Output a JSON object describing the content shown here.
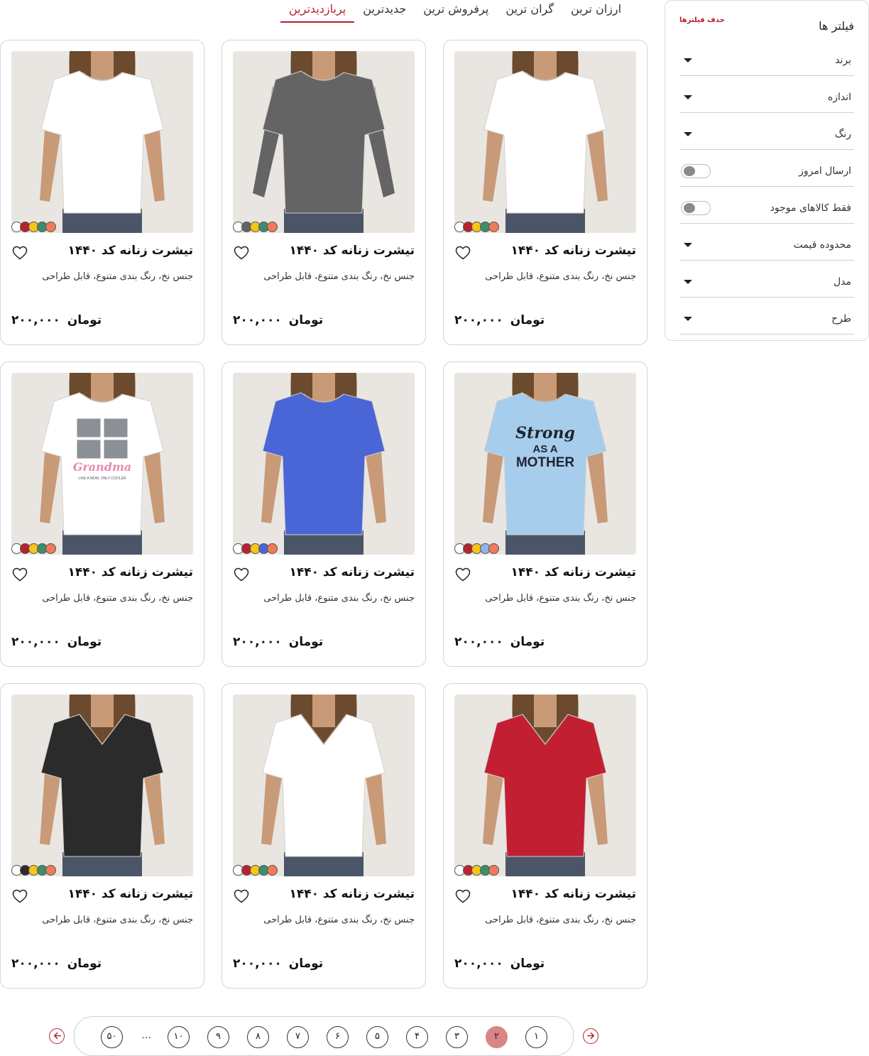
{
  "sort_tabs": [
    {
      "label": "پربازدیدترین",
      "active": true
    },
    {
      "label": "جدیدترین",
      "active": false
    },
    {
      "label": "پرفروش ترین",
      "active": false
    },
    {
      "label": "گران ترین",
      "active": false
    },
    {
      "label": "ارزان ترین",
      "active": false
    }
  ],
  "filters": {
    "title": "فیلتر ها",
    "clear_label": "حذف فیلترها",
    "items": [
      {
        "label": "برند",
        "control": "dropdown"
      },
      {
        "label": "اندازه",
        "control": "dropdown"
      },
      {
        "label": "رنگ",
        "control": "dropdown"
      },
      {
        "label": "ارسال امروز",
        "control": "toggle",
        "on": false
      },
      {
        "label": "فقط کالاهای موجود",
        "control": "toggle",
        "on": false
      },
      {
        "label": "محدوده قیمت",
        "control": "dropdown"
      },
      {
        "label": "مدل",
        "control": "dropdown"
      },
      {
        "label": "طرح",
        "control": "dropdown"
      }
    ]
  },
  "products": [
    {
      "title": "تیشرت زنانه کد ۱۴۴۰",
      "desc": "جنس نخ، رنگ بندی متنوع، قابل طراحی",
      "price": "۲۰۰,۰۰۰",
      "currency": "تومان",
      "shirt_color": "#ffffff",
      "sleeve": "short",
      "neck": "crew",
      "print": "",
      "swatches": [
        "#ffffff",
        "#b8222e",
        "#f5c518",
        "#3a8f6a",
        "#f07a5a"
      ]
    },
    {
      "title": "تیشرت زنانه کد ۱۴۴۰",
      "desc": "جنس نخ، رنگ بندی متنوع، قابل طراحی",
      "price": "۲۰۰,۰۰۰",
      "currency": "تومان",
      "shirt_color": "#646464",
      "sleeve": "long",
      "neck": "crew",
      "print": "",
      "swatches": [
        "#ffffff",
        "#646464",
        "#f5c518",
        "#3a8f6a",
        "#f07a5a"
      ]
    },
    {
      "title": "تیشرت زنانه کد ۱۴۴۰",
      "desc": "جنس نخ، رنگ بندی متنوع، قابل طراحی",
      "price": "۲۰۰,۰۰۰",
      "currency": "تومان",
      "shirt_color": "#ffffff",
      "sleeve": "short",
      "neck": "crew",
      "print": "",
      "swatches": [
        "#ffffff",
        "#b8222e",
        "#f5c518",
        "#3a8f6a",
        "#f07a5a"
      ]
    },
    {
      "title": "تیشرت زنانه کد ۱۴۴۰",
      "desc": "جنس نخ، رنگ بندی متنوع، قابل طراحی",
      "price": "۲۰۰,۰۰۰",
      "currency": "تومان",
      "shirt_color": "#a7cdec",
      "sleeve": "short",
      "neck": "crew",
      "print": "strong",
      "print_lines": [
        "Strong",
        "AS A",
        "MOTHER"
      ],
      "swatches": [
        "#ffffff",
        "#b8222e",
        "#f5c518",
        "#8fb4ea",
        "#f07a5a"
      ]
    },
    {
      "title": "تیشرت زنانه کد ۱۴۴۰",
      "desc": "جنس نخ، رنگ بندی متنوع، قابل طراحی",
      "price": "۲۰۰,۰۰۰",
      "currency": "تومان",
      "shirt_color": "#4a66d6",
      "sleeve": "short",
      "neck": "crew",
      "print": "",
      "swatches": [
        "#ffffff",
        "#b8222e",
        "#f5c518",
        "#4a66d6",
        "#f07a5a"
      ]
    },
    {
      "title": "تیشرت زنانه کد ۱۴۴۰",
      "desc": "جنس نخ، رنگ بندی متنوع، قابل طراحی",
      "price": "۲۰۰,۰۰۰",
      "currency": "تومان",
      "shirt_color": "#ffffff",
      "sleeve": "short",
      "neck": "crew",
      "print": "grandma",
      "print_lines": [
        "Grandma",
        "LIKE A MOM, ONLY COOLER"
      ],
      "swatches": [
        "#ffffff",
        "#b8222e",
        "#f5c518",
        "#3a8f6a",
        "#f07a5a"
      ]
    },
    {
      "title": "تیشرت زنانه کد ۱۴۴۰",
      "desc": "جنس نخ، رنگ بندی متنوع، قابل طراحی",
      "price": "۲۰۰,۰۰۰",
      "currency": "تومان",
      "shirt_color": "#c21f32",
      "sleeve": "short",
      "neck": "v",
      "print": "",
      "swatches": [
        "#ffffff",
        "#c21f32",
        "#f5c518",
        "#3a8f6a",
        "#f07a5a"
      ]
    },
    {
      "title": "تیشرت زنانه کد ۱۴۴۰",
      "desc": "جنس نخ، رنگ بندی متنوع، قابل طراحی",
      "price": "۲۰۰,۰۰۰",
      "currency": "تومان",
      "shirt_color": "#ffffff",
      "sleeve": "short",
      "neck": "v",
      "print": "",
      "swatches": [
        "#ffffff",
        "#b8222e",
        "#f5c518",
        "#3a8f6a",
        "#f07a5a"
      ]
    },
    {
      "title": "تیشرت زنانه کد ۱۴۴۰",
      "desc": "جنس نخ، رنگ بندی متنوع، قابل طراحی",
      "price": "۲۰۰,۰۰۰",
      "currency": "تومان",
      "shirt_color": "#2b2b2b",
      "sleeve": "short",
      "neck": "v",
      "print": "",
      "swatches": [
        "#ffffff",
        "#2b2b2b",
        "#f5c518",
        "#3a8f6a",
        "#f07a5a"
      ]
    }
  ],
  "pagination": {
    "pages": [
      "۱",
      "۲",
      "۳",
      "۴",
      "۵",
      "۶",
      "۷",
      "۸",
      "۹",
      "۱۰"
    ],
    "active": "۲",
    "ellipsis": "…",
    "last": "۵۰"
  },
  "colors": {
    "accent": "#b8222e",
    "active_page": "#d98585"
  }
}
